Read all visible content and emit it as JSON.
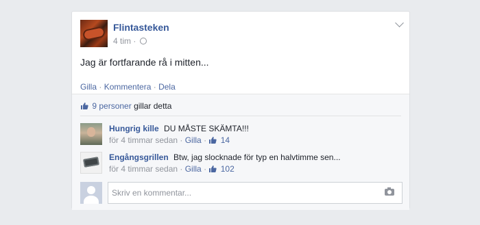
{
  "post": {
    "page_name": "Flintasteken",
    "time": "4 tim",
    "meta_sep": "·",
    "text": "Jag är fortfarande rå i mitten...",
    "actions": {
      "like": "Gilla",
      "comment": "Kommentera",
      "share": "Dela",
      "sep": " · "
    }
  },
  "likes": {
    "people": "9 personer",
    "suffix": "gillar detta"
  },
  "comments": [
    {
      "author": "Hungrig kille",
      "text": "DU MÅSTE SKÄMTA!!!",
      "time": "för 4 timmar sedan",
      "like": "Gilla",
      "likes": "14",
      "sep": " · "
    },
    {
      "author": "Engångsgrillen",
      "text": "Btw, jag slocknade för typ en halvtimme sen...",
      "time": "för 4 timmar sedan",
      "like": "Gilla",
      "likes": "102",
      "sep": " · "
    }
  ],
  "composer": {
    "placeholder": "Skriv en kommentar..."
  },
  "icons": {
    "privacy": "globe-icon",
    "menu": "chevron-down-icon",
    "like": "thumbs-up-icon",
    "attach": "camera-icon"
  },
  "colors": {
    "link": "#4b67a1",
    "name": "#365899",
    "muted": "#90949c",
    "background": "#e9ebee"
  }
}
